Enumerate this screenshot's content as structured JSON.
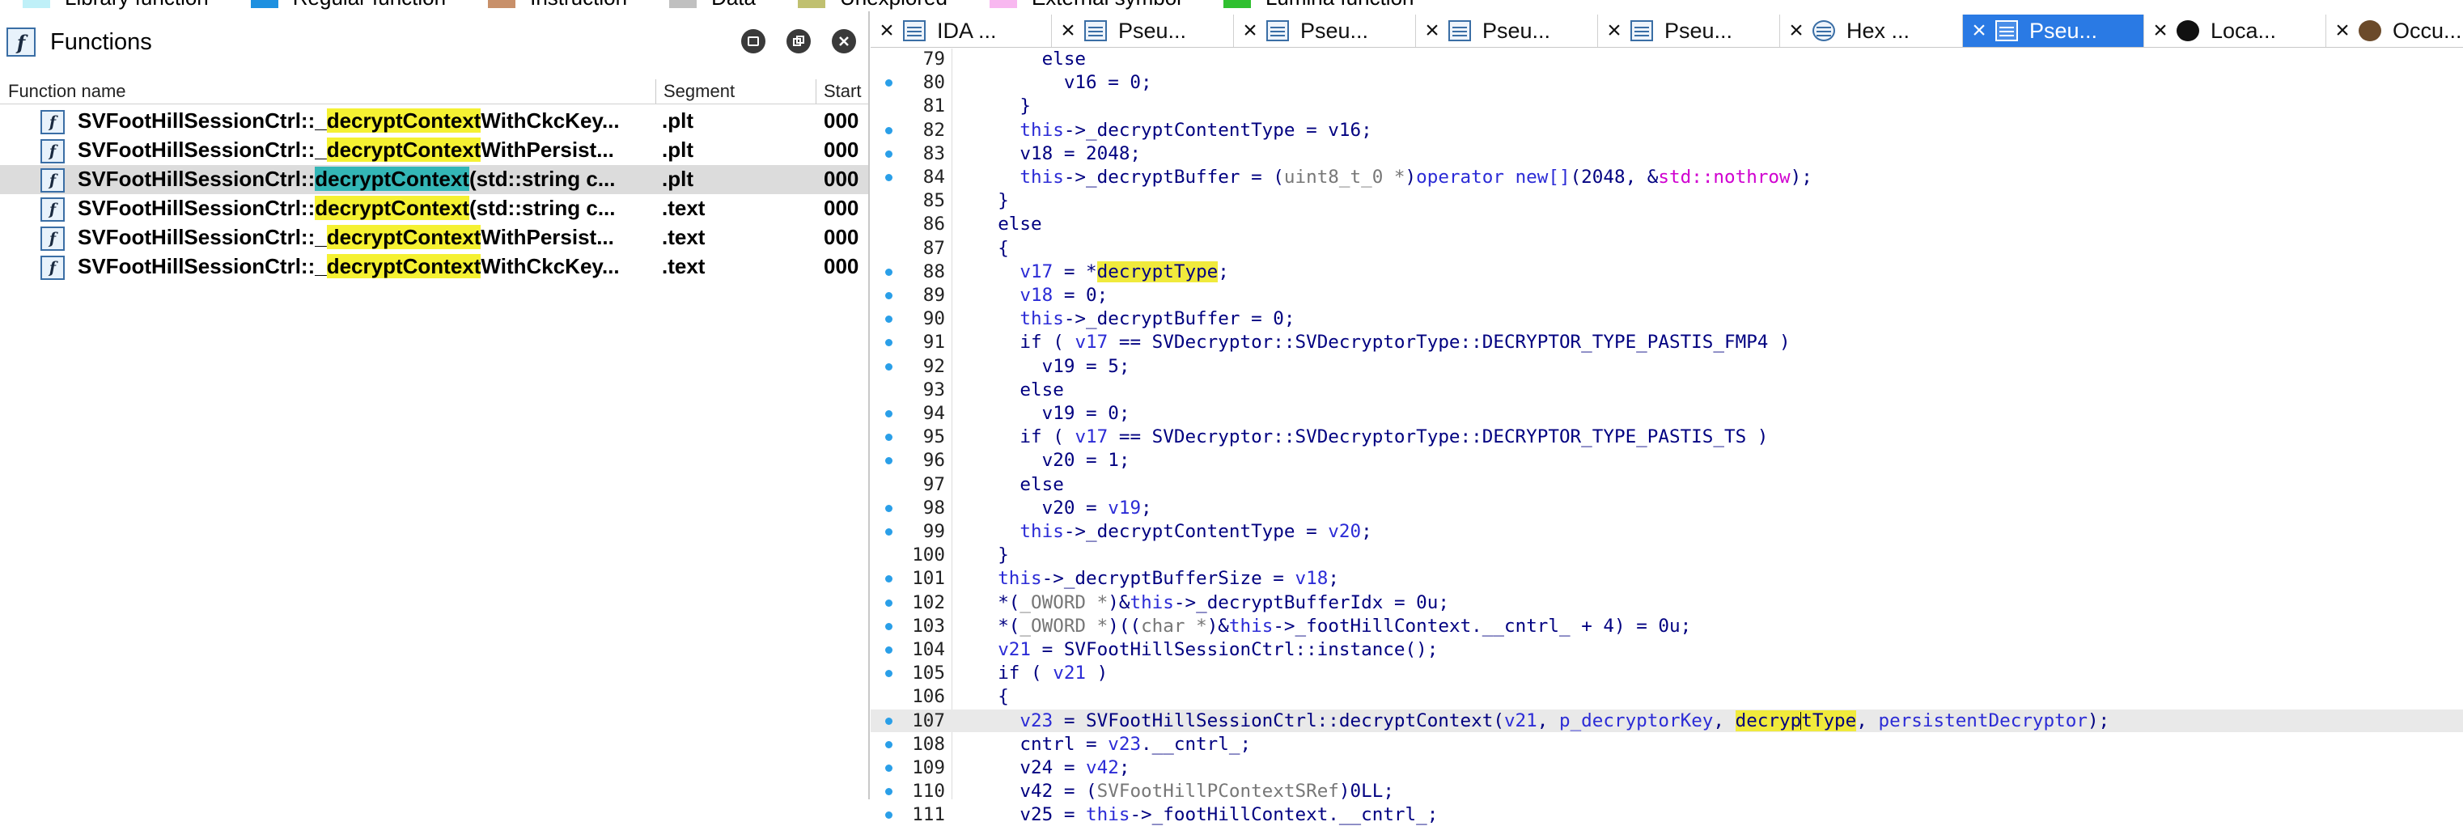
{
  "legend": [
    {
      "label": "Library function",
      "color": "#bff0f8"
    },
    {
      "label": "Regular function",
      "color": "#1e90e0"
    },
    {
      "label": "Instruction",
      "color": "#c8906a"
    },
    {
      "label": "Data",
      "color": "#c0c0c0"
    },
    {
      "label": "Unexplored",
      "color": "#c0c070"
    },
    {
      "label": "External symbol",
      "color": "#f8b8f0"
    },
    {
      "label": "Lumina function",
      "color": "#30c030"
    }
  ],
  "functions_panel": {
    "title": "Functions",
    "columns": {
      "name": "Function name",
      "segment": "Segment",
      "start": "Start"
    },
    "rows": [
      {
        "prefix": "SVFootHillSessionCtrl::_",
        "match": "decryptContext",
        "suffix": "WithCkcKey...",
        "segment": ".plt",
        "start": "000",
        "selected": false
      },
      {
        "prefix": "SVFootHillSessionCtrl::_",
        "match": "decryptContext",
        "suffix": "WithPersist...",
        "segment": ".plt",
        "start": "000",
        "selected": false
      },
      {
        "prefix": "SVFootHillSessionCtrl::",
        "match": "decryptContext",
        "suffix": "(std::string c...",
        "segment": ".plt",
        "start": "000",
        "selected": true
      },
      {
        "prefix": "SVFootHillSessionCtrl::",
        "match": "decryptContext",
        "suffix": "(std::string c...",
        "segment": ".text",
        "start": "000",
        "selected": false
      },
      {
        "prefix": "SVFootHillSessionCtrl::_",
        "match": "decryptContext",
        "suffix": "WithPersist...",
        "segment": ".text",
        "start": "000",
        "selected": false
      },
      {
        "prefix": "SVFootHillSessionCtrl::_",
        "match": "decryptContext",
        "suffix": "WithCkcKey...",
        "segment": ".text",
        "start": "000",
        "selected": false
      }
    ]
  },
  "tabs": [
    {
      "label": "IDA ...",
      "icon": "ida-view-icon",
      "active": false
    },
    {
      "label": "Pseu...",
      "icon": "pseudocode-icon",
      "active": false
    },
    {
      "label": "Pseu...",
      "icon": "pseudocode-icon",
      "active": false
    },
    {
      "label": "Pseu...",
      "icon": "pseudocode-icon",
      "active": false
    },
    {
      "label": "Pseu...",
      "icon": "pseudocode-icon",
      "active": false
    },
    {
      "label": "Hex ...",
      "icon": "hex-view-icon",
      "active": false
    },
    {
      "label": "Pseu...",
      "icon": "pseudocode-icon",
      "active": true
    },
    {
      "label": "Loca...",
      "icon": "locals-icon",
      "active": false
    },
    {
      "label": "Occu...",
      "icon": "occurrences-icon",
      "active": false
    }
  ],
  "code_lines": [
    {
      "n": "79",
      "dot": false,
      "cur": false,
      "t": [
        [
          "kw",
          "      else"
        ]
      ]
    },
    {
      "n": "80",
      "dot": true,
      "cur": false,
      "t": [
        [
          "kw",
          "        v16 = 0;"
        ]
      ]
    },
    {
      "n": "81",
      "dot": false,
      "cur": false,
      "t": [
        [
          "kw",
          "    }"
        ]
      ]
    },
    {
      "n": "82",
      "dot": true,
      "cur": false,
      "t": [
        [
          "v",
          "    this"
        ],
        [
          "kw",
          "->_decryptContentType = v16;"
        ]
      ]
    },
    {
      "n": "83",
      "dot": true,
      "cur": false,
      "t": [
        [
          "kw",
          "    v18 = 2048;"
        ]
      ]
    },
    {
      "n": "84",
      "dot": true,
      "cur": false,
      "t": [
        [
          "v",
          "    this"
        ],
        [
          "kw",
          "->_decryptBuffer = ("
        ],
        [
          "g",
          "uint8_t_0 *"
        ],
        [
          "kw",
          ")"
        ],
        [
          "v",
          "operator new[]"
        ],
        [
          "kw",
          "(2048, &"
        ],
        [
          "ns",
          "std::nothrow"
        ],
        [
          "kw",
          ");"
        ]
      ]
    },
    {
      "n": "85",
      "dot": false,
      "cur": false,
      "t": [
        [
          "kw",
          "  }"
        ]
      ]
    },
    {
      "n": "86",
      "dot": false,
      "cur": false,
      "t": [
        [
          "kw",
          "  else"
        ]
      ]
    },
    {
      "n": "87",
      "dot": false,
      "cur": false,
      "t": [
        [
          "kw",
          "  {"
        ]
      ]
    },
    {
      "n": "88",
      "dot": true,
      "cur": false,
      "t": [
        [
          "v",
          "    v17"
        ],
        [
          "kw",
          " = *"
        ],
        [
          "hy",
          "decryptType"
        ],
        [
          "kw",
          ";"
        ]
      ]
    },
    {
      "n": "89",
      "dot": true,
      "cur": false,
      "t": [
        [
          "v",
          "    v18"
        ],
        [
          "kw",
          " = 0;"
        ]
      ]
    },
    {
      "n": "90",
      "dot": true,
      "cur": false,
      "t": [
        [
          "v",
          "    this"
        ],
        [
          "kw",
          "->_decryptBuffer = 0;"
        ]
      ]
    },
    {
      "n": "91",
      "dot": true,
      "cur": false,
      "t": [
        [
          "kw",
          "    if ( "
        ],
        [
          "v",
          "v17"
        ],
        [
          "kw",
          " == SVDecryptor::SVDecryptorType::DECRYPTOR_TYPE_PASTIS_FMP4 )"
        ]
      ]
    },
    {
      "n": "92",
      "dot": true,
      "cur": false,
      "t": [
        [
          "kw",
          "      v19 = 5;"
        ]
      ]
    },
    {
      "n": "93",
      "dot": false,
      "cur": false,
      "t": [
        [
          "kw",
          "    else"
        ]
      ]
    },
    {
      "n": "94",
      "dot": true,
      "cur": false,
      "t": [
        [
          "kw",
          "      v19 = 0;"
        ]
      ]
    },
    {
      "n": "95",
      "dot": true,
      "cur": false,
      "t": [
        [
          "kw",
          "    if ( "
        ],
        [
          "v",
          "v17"
        ],
        [
          "kw",
          " == SVDecryptor::SVDecryptorType::DECRYPTOR_TYPE_PASTIS_TS )"
        ]
      ]
    },
    {
      "n": "96",
      "dot": true,
      "cur": false,
      "t": [
        [
          "kw",
          "      v20 = 1;"
        ]
      ]
    },
    {
      "n": "97",
      "dot": false,
      "cur": false,
      "t": [
        [
          "kw",
          "    else"
        ]
      ]
    },
    {
      "n": "98",
      "dot": true,
      "cur": false,
      "t": [
        [
          "kw",
          "      v20 = "
        ],
        [
          "v",
          "v19"
        ],
        [
          "kw",
          ";"
        ]
      ]
    },
    {
      "n": "99",
      "dot": true,
      "cur": false,
      "t": [
        [
          "v",
          "    this"
        ],
        [
          "kw",
          "->_decryptContentType = "
        ],
        [
          "v",
          "v20"
        ],
        [
          "kw",
          ";"
        ]
      ]
    },
    {
      "n": "100",
      "dot": false,
      "cur": false,
      "t": [
        [
          "kw",
          "  }"
        ]
      ]
    },
    {
      "n": "101",
      "dot": true,
      "cur": false,
      "t": [
        [
          "v",
          "  this"
        ],
        [
          "kw",
          "->_decryptBufferSize = "
        ],
        [
          "v",
          "v18"
        ],
        [
          "kw",
          ";"
        ]
      ]
    },
    {
      "n": "102",
      "dot": true,
      "cur": false,
      "t": [
        [
          "kw",
          "  *("
        ],
        [
          "g",
          "_OWORD *"
        ],
        [
          "kw",
          ")&"
        ],
        [
          "v",
          "this"
        ],
        [
          "kw",
          "->_decryptBufferIdx = 0u;"
        ]
      ]
    },
    {
      "n": "103",
      "dot": true,
      "cur": false,
      "t": [
        [
          "kw",
          "  *("
        ],
        [
          "g",
          "_OWORD *"
        ],
        [
          "kw",
          ")(("
        ],
        [
          "g",
          "char *"
        ],
        [
          "kw",
          ")&"
        ],
        [
          "v",
          "this"
        ],
        [
          "kw",
          "->_footHillContext.__cntrl_ + 4) = 0u;"
        ]
      ]
    },
    {
      "n": "104",
      "dot": true,
      "cur": false,
      "t": [
        [
          "v",
          "  v21"
        ],
        [
          "kw",
          " = SVFootHillSessionCtrl::instance();"
        ]
      ]
    },
    {
      "n": "105",
      "dot": true,
      "cur": false,
      "t": [
        [
          "kw",
          "  if ( "
        ],
        [
          "v",
          "v21"
        ],
        [
          "kw",
          " )"
        ]
      ]
    },
    {
      "n": "106",
      "dot": false,
      "cur": false,
      "t": [
        [
          "kw",
          "  {"
        ]
      ]
    },
    {
      "n": "107",
      "dot": true,
      "cur": true,
      "t": [
        [
          "v",
          "    v23"
        ],
        [
          "kw",
          " = SVFootHillSessionCtrl::decryptContext("
        ],
        [
          "v",
          "v21"
        ],
        [
          "kw",
          ", "
        ],
        [
          "v",
          "p_decryptorKey"
        ],
        [
          "kw",
          ", "
        ],
        [
          "hy",
          "decryp"
        ],
        [
          "cursor",
          ""
        ],
        [
          "hy",
          "tType"
        ],
        [
          "kw",
          ", "
        ],
        [
          "v",
          "persistentDecryptor"
        ],
        [
          "kw",
          ");"
        ]
      ]
    },
    {
      "n": "108",
      "dot": true,
      "cur": false,
      "t": [
        [
          "kw",
          "    cntrl = "
        ],
        [
          "v",
          "v23"
        ],
        [
          "kw",
          ".__cntrl_;"
        ]
      ]
    },
    {
      "n": "109",
      "dot": true,
      "cur": false,
      "t": [
        [
          "kw",
          "    v24 = "
        ],
        [
          "v",
          "v42"
        ],
        [
          "kw",
          ";"
        ]
      ]
    },
    {
      "n": "110",
      "dot": true,
      "cur": false,
      "t": [
        [
          "kw",
          "    v42 = ("
        ],
        [
          "g",
          "SVFootHillPContextSRef"
        ],
        [
          "kw",
          ")0LL;"
        ]
      ]
    },
    {
      "n": "111",
      "dot": true,
      "cur": false,
      "t": [
        [
          "kw",
          "    v25 = "
        ],
        [
          "v",
          "this"
        ],
        [
          "kw",
          "->_footHillContext.__cntrl_;"
        ]
      ]
    }
  ]
}
